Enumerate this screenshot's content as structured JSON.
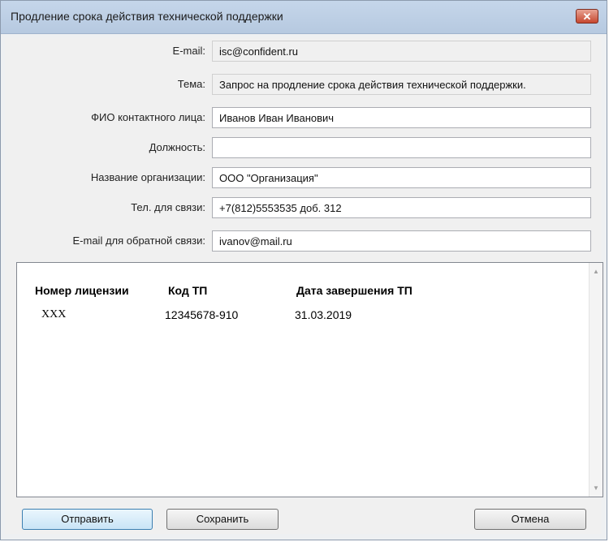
{
  "window": {
    "title": "Продление срока действия технической поддержки",
    "close_glyph": "✕"
  },
  "form": {
    "email": {
      "label": "E-mail:",
      "value": "isc@confident.ru"
    },
    "subject": {
      "label": "Тема:",
      "value": "Запрос на продление срока действия технической поддержки."
    },
    "contact_name": {
      "label": "ФИО контактного лица:",
      "value": "Иванов Иван Иванович"
    },
    "position": {
      "label": "Должность:",
      "value": ""
    },
    "organization": {
      "label": "Название организации:",
      "value": "ООО \"Организация\""
    },
    "phone": {
      "label": "Тел. для связи:",
      "value": "+7(812)5553535 доб. 312"
    },
    "reply_email": {
      "label": "E-mail для обратной связи:",
      "value": "ivanov@mail.ru"
    }
  },
  "license_table": {
    "headers": [
      "Номер лицензии",
      "Код ТП",
      "Дата завершения ТП"
    ],
    "rows": [
      [
        "XXX",
        "12345678-910",
        "31.03.2019"
      ]
    ]
  },
  "buttons": {
    "send": "Отправить",
    "save": "Сохранить",
    "cancel": "Отмена"
  }
}
